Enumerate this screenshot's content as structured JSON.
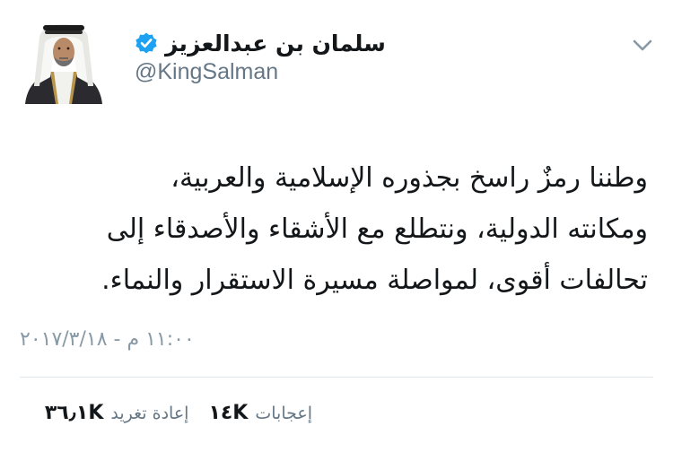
{
  "author": {
    "display_name": "سلمان بن عبدالعزيز",
    "handle": "@KingSalman",
    "verified": true,
    "avatar_icon": "avatar-portrait",
    "verified_icon": "verified-badge-icon"
  },
  "menu": {
    "icon": "chevron-down-icon"
  },
  "tweet": {
    "lines": [
      "وطننا رمزٌ راسخ بجذوره الإسلامية والعربية،",
      "ومكانته الدولية، ونتطلع مع الأشقاء والأصدقاء إلى",
      "تحالفات أقوى، لمواصلة مسيرة الاستقرار والنماء."
    ],
    "timestamp": "١١:٠٠ م - ٢٠١٧/٣/١٨"
  },
  "stats": {
    "retweets_label": "إعادة تغريد",
    "retweets_count": "٣٦٫١K",
    "likes_label": "إعجابات",
    "likes_count": "١٤K"
  },
  "colors": {
    "text_primary": "#14171a",
    "text_secondary": "#657786",
    "timestamp": "#8899a6",
    "verified_blue": "#1da1f2",
    "divider": "#e1e8ed"
  }
}
